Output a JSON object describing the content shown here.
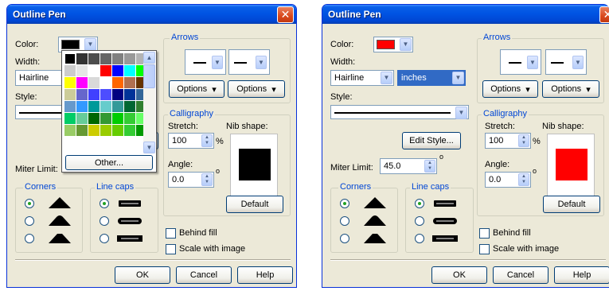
{
  "dialogs": [
    {
      "title": "Outline Pen",
      "close": "✕",
      "color_label": "Color:",
      "color_value": "#000000",
      "width_label": "Width:",
      "width_value": "Hairline",
      "style_label": "Style:",
      "miter_label": "Miter Limit:",
      "arrows_label": "Arrows",
      "options1": "Options",
      "options2": "Options",
      "calligraphy_label": "Calligraphy",
      "stretch_label": "Stretch:",
      "stretch_value": "100",
      "stretch_unit": "%",
      "angle_label": "Angle:",
      "angle_value": "0.0",
      "angle_unit": "o",
      "nib_label": "Nib shape:",
      "nib_color": "#000000",
      "default_button": "Default",
      "corners_label": "Corners",
      "linecaps_label": "Line caps",
      "behind_fill": "Behind fill",
      "scale_with_image": "Scale with image",
      "ok": "OK",
      "cancel": "Cancel",
      "help": "Help",
      "color_popup": {
        "other_button": "Other...",
        "palette": [
          "#000000",
          "#333333",
          "#4d4d4d",
          "#666666",
          "#808080",
          "#999999",
          "#b3b3b3",
          "#cccccc",
          "#e5e5e5",
          "#ffffff",
          "#ff0000",
          "#0000ff",
          "#00ffff",
          "#00ff00",
          "#ffff00",
          "#ff00ff",
          "#d9d9d9",
          "#ffffff",
          "#ff6600",
          "#b07050",
          "#663300",
          "#cccc99",
          "#6666cc",
          "#4040ff",
          "#4d4dff",
          "#000080",
          "#003399",
          "#336699",
          "#6699cc",
          "#3399ff",
          "#009999",
          "#66cccc",
          "#339999",
          "#006633",
          "#2f7f2f",
          "#00cc66",
          "#66cc99",
          "#006600",
          "#339933",
          "#00cc00",
          "#33cc33",
          "#66ff66",
          "#99cc66",
          "#669933",
          "#cccc00",
          "#99cc00",
          "#66cc00",
          "#33cc33",
          "#009900"
        ]
      }
    },
    {
      "title": "Outline Pen",
      "close": "✕",
      "color_label": "Color:",
      "color_value": "#ff0000",
      "width_label": "Width:",
      "width_value": "Hairline",
      "units_value": "inches",
      "style_label": "Style:",
      "edit_style_button": "Edit Style...",
      "miter_label": "Miter Limit:",
      "miter_value": "45.0",
      "miter_unit": "o",
      "arrows_label": "Arrows",
      "options1": "Options",
      "options2": "Options",
      "calligraphy_label": "Calligraphy",
      "stretch_label": "Stretch:",
      "stretch_value": "100",
      "stretch_unit": "%",
      "angle_label": "Angle:",
      "angle_value": "0.0",
      "angle_unit": "o",
      "nib_label": "Nib shape:",
      "nib_color": "#ff0000",
      "default_button": "Default",
      "corners_label": "Corners",
      "linecaps_label": "Line caps",
      "behind_fill": "Behind fill",
      "scale_with_image": "Scale with image",
      "ok": "OK",
      "cancel": "Cancel",
      "help": "Help"
    }
  ]
}
